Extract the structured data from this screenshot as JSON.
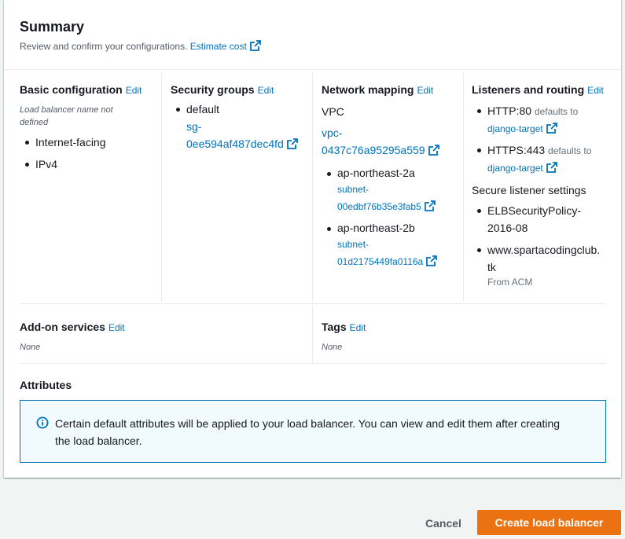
{
  "summary": {
    "title": "Summary",
    "subtitle": "Review and confirm your configurations.",
    "estimate_link": "Estimate cost"
  },
  "basic": {
    "title": "Basic configuration",
    "edit": "Edit",
    "name_line1": "Load balancer name not",
    "name_line2": "defined",
    "items": [
      "Internet-facing",
      "IPv4"
    ]
  },
  "security": {
    "title": "Security groups",
    "edit": "Edit",
    "group": "default",
    "sg_line1": "sg-",
    "sg_line2": "0ee594af487dec4fd"
  },
  "network": {
    "title": "Network mapping",
    "edit": "Edit",
    "vpc_label": "VPC",
    "vpc_line1": "vpc-",
    "vpc_line2": "0437c76a95295a559",
    "subnets": [
      {
        "az": "ap-northeast-2a",
        "line1": "subnet-",
        "line2": "00edbf76b35e3fab5"
      },
      {
        "az": "ap-northeast-2b",
        "line1": "subnet-",
        "line2": "01d2175449fa0116a"
      }
    ]
  },
  "listeners": {
    "title": "Listeners and routing",
    "edit": "Edit",
    "items": [
      {
        "proto": "HTTP:80",
        "defaults": "defaults to",
        "target": "django-target"
      },
      {
        "proto": "HTTPS:443",
        "defaults": "defaults to",
        "target": "django-target"
      }
    ],
    "secure_title": "Secure listener settings",
    "policy_line1": "ELBSecurityPolicy-",
    "policy_line2": "2016-08",
    "cert_line1": "www.spartacodingclub.",
    "cert_line2": "tk",
    "cert_source": "From ACM"
  },
  "addon": {
    "title": "Add-on services",
    "edit": "Edit",
    "value": "None"
  },
  "tags": {
    "title": "Tags",
    "edit": "Edit",
    "value": "None"
  },
  "attributes": {
    "title": "Attributes",
    "info_line1": "Certain default attributes will be applied to your load balancer. You can view and edit them after creating",
    "info_line2": "the load balancer."
  },
  "footer": {
    "cancel": "Cancel",
    "create": "Create load balancer"
  },
  "colors": {
    "link": "#0073bb",
    "primary": "#ec7211",
    "info_bg": "#f1faff"
  }
}
